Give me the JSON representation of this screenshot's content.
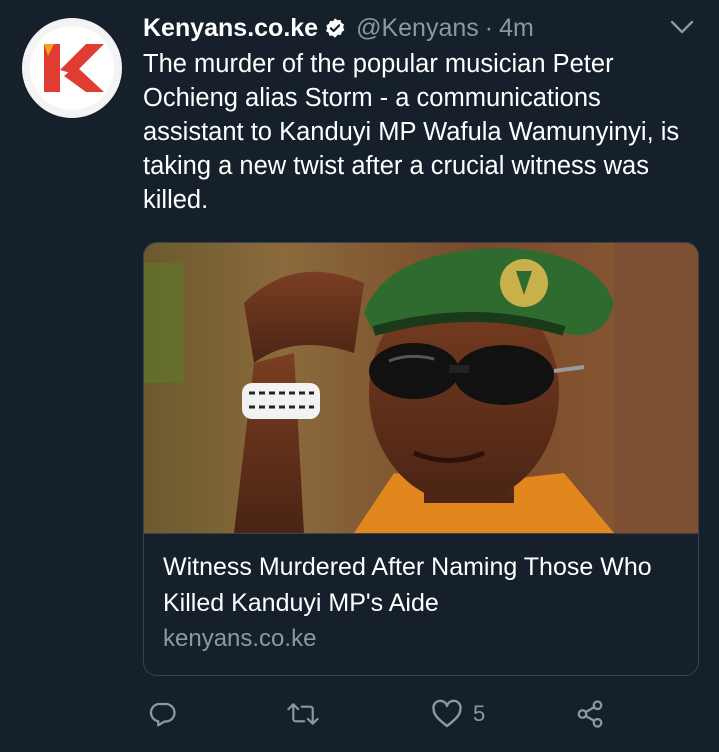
{
  "tweet": {
    "display_name": "Kenyans.co.ke",
    "verified_icon": "verified-badge-icon",
    "handle": "@Kenyans",
    "separator": "·",
    "time": "4m",
    "text": "The murder of the popular musician Peter Ochieng alias Storm - a communications assistant to Kanduyi MP Wafula Wamunyinyi, is taking a new twist after a crucial witness was killed."
  },
  "avatar": {
    "logo_letter": "K",
    "brand_color": "#e03c31",
    "accent_color": "#f4a01c"
  },
  "card": {
    "title": "Witness Murdered After Naming Those Who Killed Kanduyi MP's Aide",
    "domain": "kenyans.co.ke"
  },
  "actions": {
    "reply_icon": "reply-icon",
    "retweet_icon": "retweet-icon",
    "like_icon": "heart-icon",
    "like_count": "5",
    "share_icon": "share-icon"
  },
  "colors": {
    "background": "#15202b",
    "border": "#38444d",
    "secondary_text": "#8899a6",
    "primary_text": "#ffffff"
  }
}
